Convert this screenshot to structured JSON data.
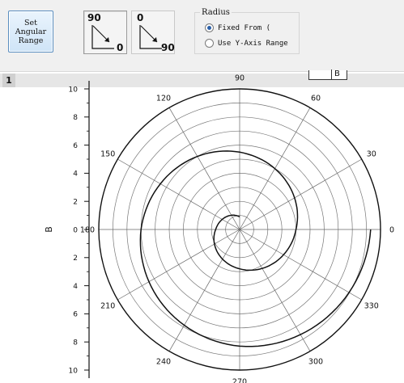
{
  "toolbar": {
    "set_button": "Set\nAngular\nRange",
    "ccw": {
      "top": "90",
      "bottom": "0"
    },
    "cw": {
      "top": "0",
      "bottom": "90"
    },
    "radius": {
      "title": "Radius",
      "options": [
        "Fixed From (",
        "Use Y-Axis Range"
      ],
      "selected": "Fixed From ("
    }
  },
  "layer": {
    "number": "1"
  },
  "legend": {
    "label": "B"
  },
  "chart_data": {
    "type": "polar",
    "angular_ticks": [
      "0",
      "30",
      "60",
      "90",
      "120",
      "150",
      "180",
      "210",
      "240",
      "270",
      "300",
      "330"
    ],
    "y_axis": {
      "title": "B",
      "tick_labels_upper": [
        "10",
        "8",
        "6",
        "4",
        "2",
        "0"
      ],
      "tick_labels_lower": [
        "2",
        "4",
        "6",
        "8",
        "10"
      ],
      "range": [
        0,
        10
      ]
    },
    "radial_rings": 10,
    "grid": true,
    "series": [
      {
        "name": "B",
        "theta_deg": [
          90,
          180,
          270,
          360,
          450,
          540,
          630,
          720
        ],
        "r": [
          0.9,
          1.7,
          2.8,
          4.0,
          5.5,
          7.0,
          8.3,
          9.3
        ]
      }
    ]
  }
}
